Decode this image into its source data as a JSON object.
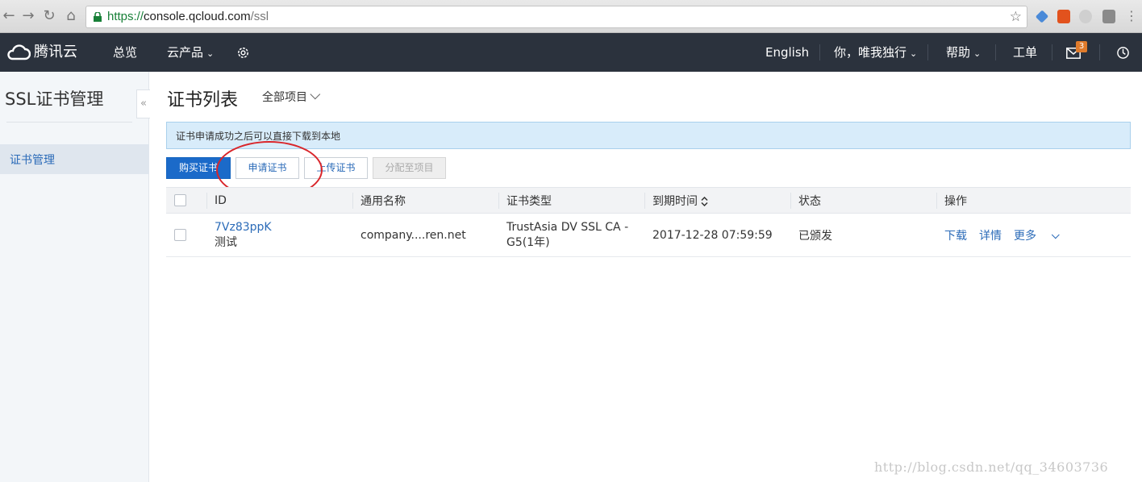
{
  "browser": {
    "url_scheme": "https://",
    "url_host": "console.qcloud.com",
    "url_path": "/ssl"
  },
  "topnav": {
    "brand": "腾讯云",
    "overview": "总览",
    "products": "云产品",
    "language": "English",
    "user": "你，唯我独行",
    "help": "帮助",
    "ticket": "工单",
    "message_count": "3"
  },
  "sidebar": {
    "title": "SSL证书管理",
    "items": [
      {
        "label": "证书管理"
      }
    ]
  },
  "main": {
    "title": "证书列表",
    "project_filter": "全部项目",
    "notice": "证书申请成功之后可以直接下载到本地",
    "buttons": {
      "buy": "购买证书",
      "apply": "申请证书",
      "upload": "上传证书",
      "assign": "分配至项目"
    },
    "table": {
      "headers": [
        "ID",
        "通用名称",
        "证书类型",
        "到期时间",
        "状态",
        "操作"
      ],
      "rows": [
        {
          "id": "7Vz83ppK",
          "note": "测试",
          "common_name": "company....ren.net",
          "type_line1": "TrustAsia DV SSL CA -",
          "type_line2": "G5(1年)",
          "expires": "2017-12-28 07:59:59",
          "status": "已颁发",
          "action_download": "下载",
          "action_detail": "详情",
          "action_more": "更多"
        }
      ]
    }
  },
  "watermark": "http://blog.csdn.net/qq_34603736",
  "colors": {
    "nav_bg": "#2b323d",
    "primary": "#1b6ac9",
    "link": "#2b6bb8",
    "success": "#2a9a4a",
    "highlight_circle": "#d9252a"
  }
}
